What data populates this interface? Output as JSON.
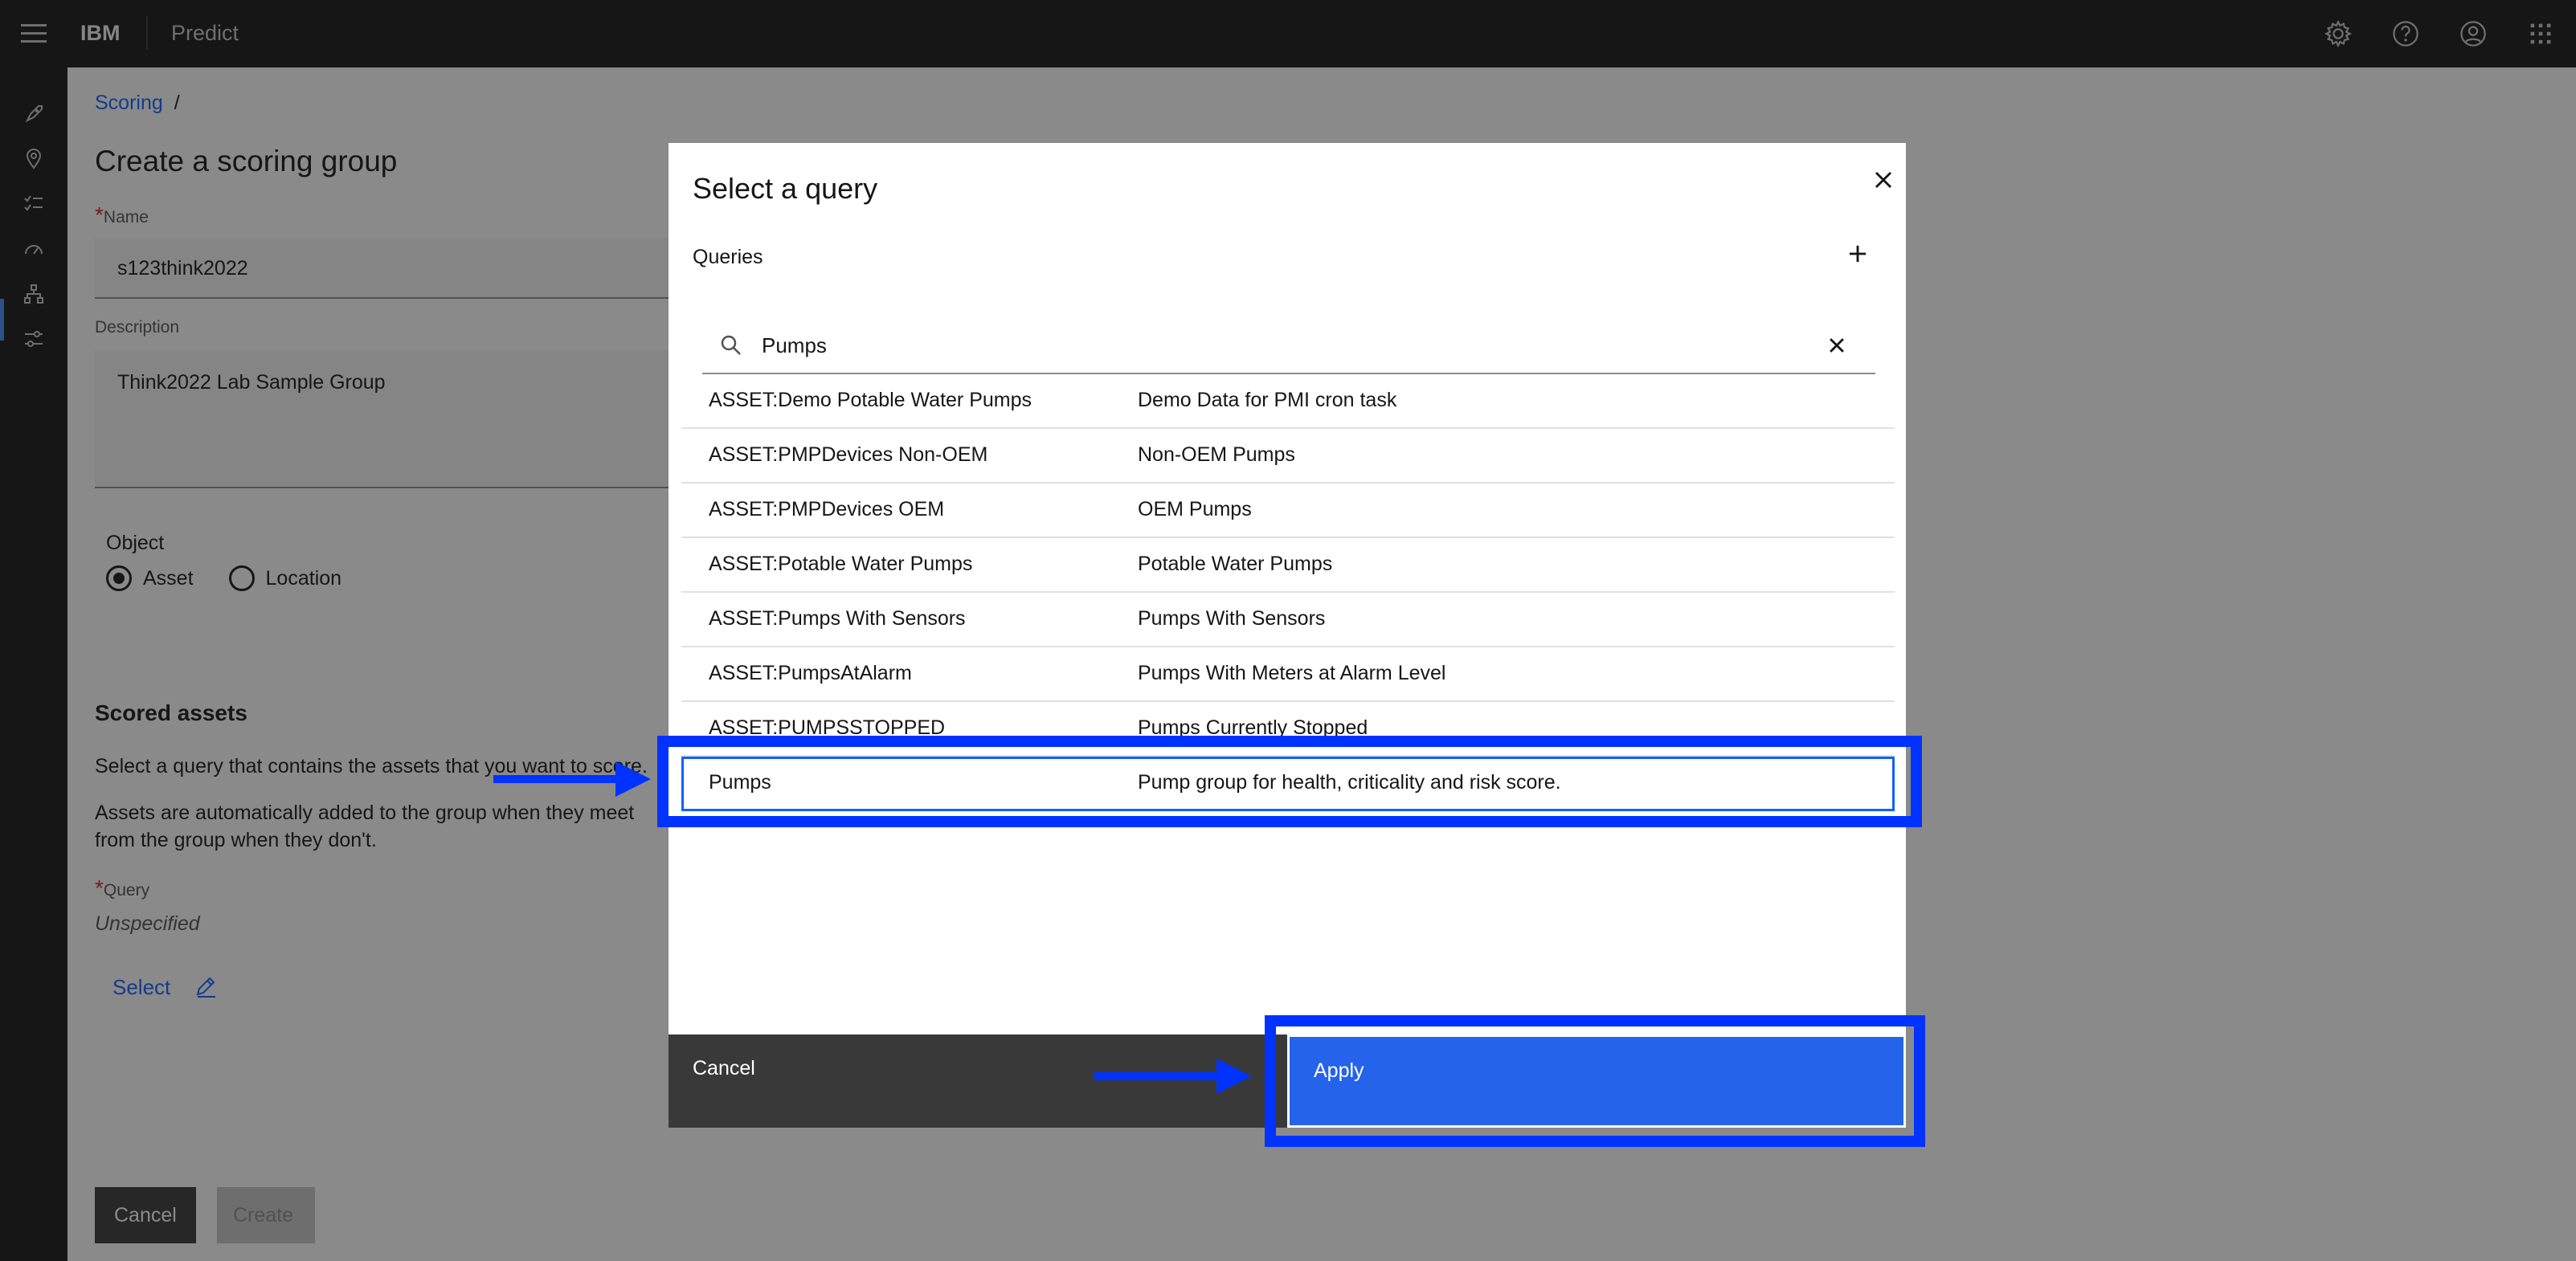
{
  "header": {
    "brand": "IBM",
    "product": "Predict",
    "icons": [
      "settings-icon",
      "help-icon",
      "user-icon",
      "app-switcher-icon"
    ]
  },
  "rail": {
    "icons": [
      "rocket-icon",
      "location-icon",
      "checklist-icon",
      "gauge-icon",
      "hierarchy-icon",
      "sliders-icon"
    ],
    "active": "gauge-icon"
  },
  "page": {
    "breadcrumb": {
      "link": "Scoring",
      "separator": "/"
    },
    "title": "Create a scoring group",
    "name_label": "Name",
    "name_value": "s123think2022",
    "description_label": "Description",
    "description_value": "Think2022 Lab Sample Group",
    "object_label": "Object",
    "object_options": [
      {
        "label": "Asset",
        "selected": true
      },
      {
        "label": "Location",
        "selected": false
      }
    ],
    "scored_assets_title": "Scored assets",
    "scored_assets_help": "Select a query that contains the assets that you want to score.",
    "scored_assets_auto_line1": "Assets are automatically added to the group when they meet",
    "scored_assets_auto_line2": "from the group when they don't.",
    "query_label": "Query",
    "query_value": "Unspecified",
    "select_link": "Select",
    "cancel_button": "Cancel",
    "create_button": "Create"
  },
  "modal": {
    "title": "Select a query",
    "queries_label": "Queries",
    "search_value": "Pumps",
    "rows": [
      {
        "name": "ASSET:Demo Potable Water Pumps",
        "description": "Demo Data for PMI cron task"
      },
      {
        "name": "ASSET:PMPDevices Non-OEM",
        "description": "Non-OEM Pumps"
      },
      {
        "name": "ASSET:PMPDevices OEM",
        "description": "OEM Pumps"
      },
      {
        "name": "ASSET:Potable Water Pumps",
        "description": "Potable Water Pumps"
      },
      {
        "name": "ASSET:Pumps With Sensors",
        "description": "Pumps With Sensors"
      },
      {
        "name": "ASSET:PumpsAtAlarm",
        "description": "Pumps With Meters at Alarm Level"
      },
      {
        "name": "ASSET:PUMPSSTOPPED",
        "description": "Pumps Currently Stopped"
      },
      {
        "name": "Pumps",
        "description": "Pump group for health, criticality and risk score."
      }
    ],
    "selected_row": "Pumps",
    "cancel_button": "Cancel",
    "apply_button": "Apply"
  },
  "colors": {
    "accent": "#0f62fe",
    "apply_bg": "#2563eb",
    "highlight": "#0033ff",
    "header_bg": "#161616"
  }
}
